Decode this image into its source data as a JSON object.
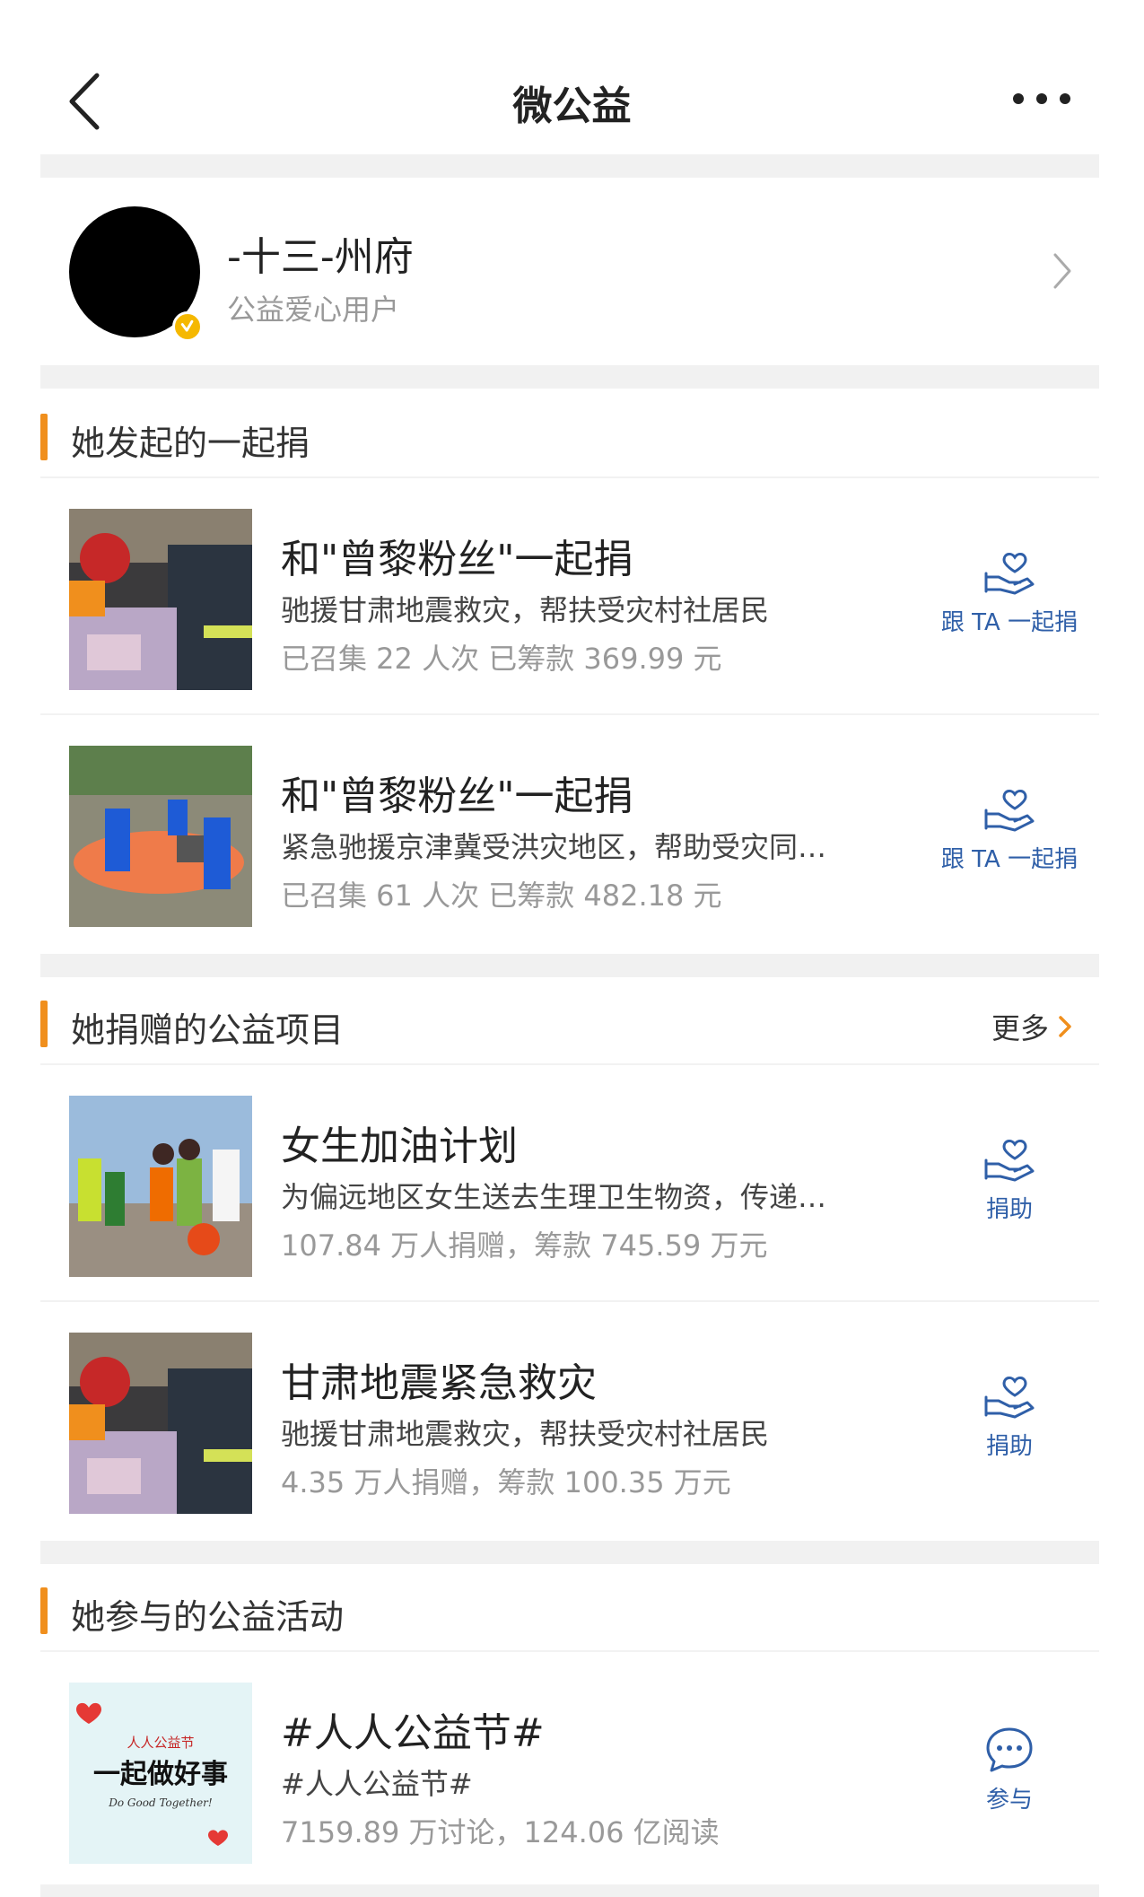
{
  "header": {
    "title": "微公益",
    "back_icon": "chevron-left-icon",
    "more_icon": "more-dots-icon"
  },
  "profile": {
    "name": "-十三-州府",
    "role": "公益爱心用户"
  },
  "sections": {
    "launched": {
      "title": "她发起的一起捐",
      "items": [
        {
          "title": "和\"曾黎粉丝\"一起捐",
          "subtitle": "驰援甘肃地震救灾，帮扶受灾村社居民",
          "stats": "已召集 22 人次 已筹款 369.99 元",
          "action": "跟 TA 一起捐"
        },
        {
          "title": "和\"曾黎粉丝\"一起捐",
          "subtitle": "紧急驰援京津冀受洪灾地区，帮助受灾同…",
          "stats": "已召集 61 人次 已筹款 482.18 元",
          "action": "跟 TA 一起捐"
        }
      ]
    },
    "donated": {
      "title": "她捐赠的公益项目",
      "more": "更多",
      "items": [
        {
          "title": "女生加油计划",
          "subtitle": "为偏远地区女生送去生理卫生物资，传递…",
          "stats": "107.84 万人捐赠，筹款 745.59 万元",
          "action": "捐助"
        },
        {
          "title": "甘肃地震紧急救灾",
          "subtitle": "驰援甘肃地震救灾，帮扶受灾村社居民",
          "stats": "4.35 万人捐赠，筹款 100.35 万元",
          "action": "捐助"
        }
      ]
    },
    "activities": {
      "title": "她参与的公益活动",
      "items": [
        {
          "title": "#人人公益节#",
          "subtitle": "#人人公益节#",
          "stats": "7159.89 万讨论，124.06 亿阅读",
          "action": "参与",
          "logo_text": "人人公益节",
          "logo_slogan": "一起做好事",
          "logo_slogan_en": "Do Good Together!"
        }
      ]
    }
  },
  "colors": {
    "accent": "#f08f1d",
    "link": "#2f5fa8",
    "divider": "#f1f1f1",
    "badge": "#f5b800"
  }
}
